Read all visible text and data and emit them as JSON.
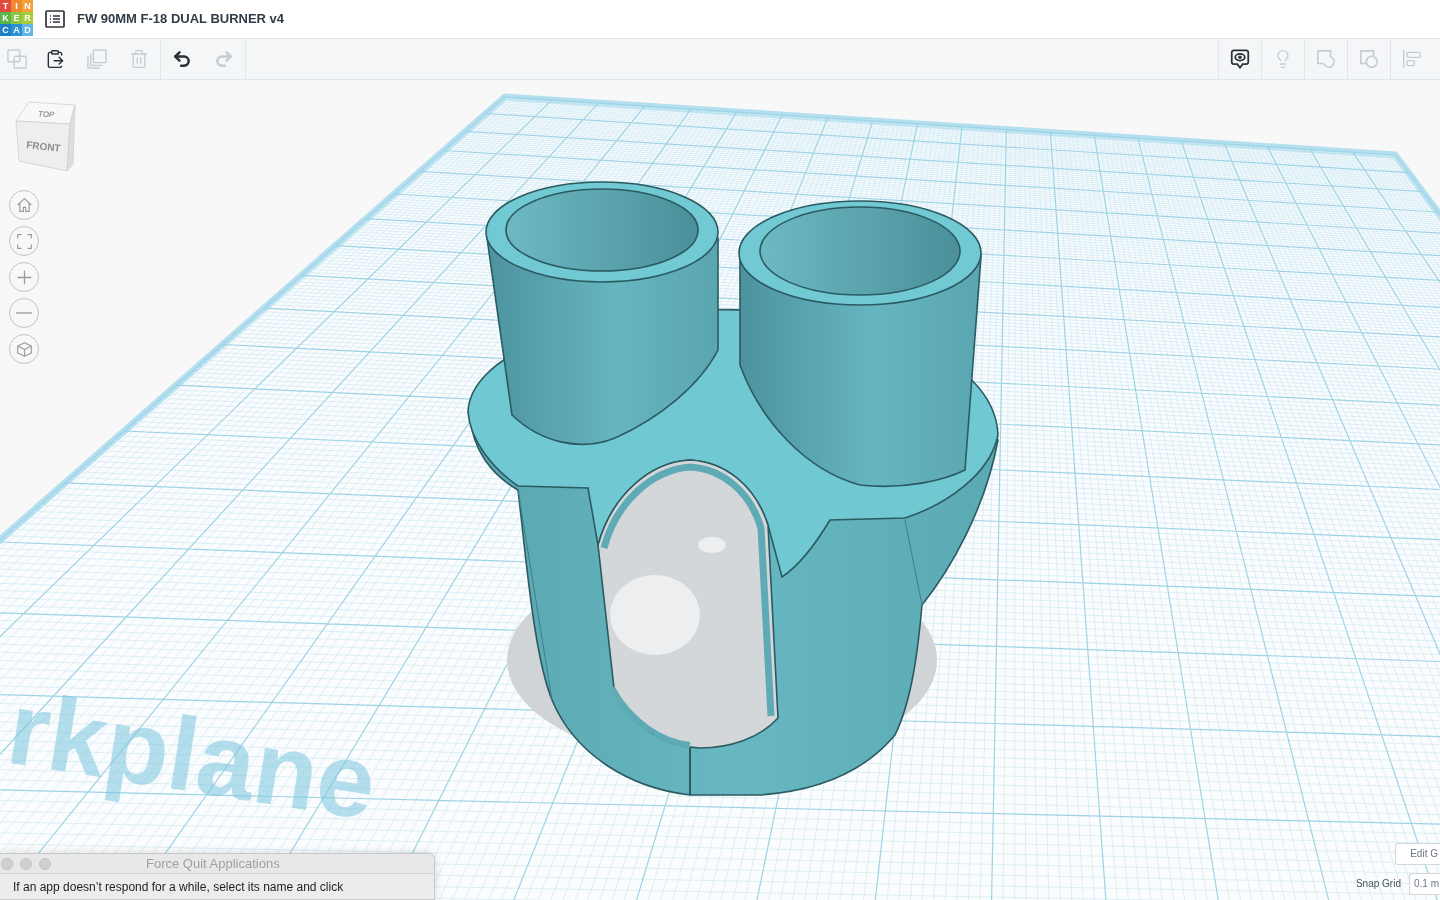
{
  "logo": [
    {
      "letter": "T",
      "color": "#e5483f"
    },
    {
      "letter": "I",
      "color": "#f0892e"
    },
    {
      "letter": "N",
      "color": "#f5a13a"
    },
    {
      "letter": "K",
      "color": "#59b548"
    },
    {
      "letter": "E",
      "color": "#8cc63f"
    },
    {
      "letter": "R",
      "color": "#a5cd39"
    },
    {
      "letter": "C",
      "color": "#1f7fc4"
    },
    {
      "letter": "A",
      "color": "#2a91d2"
    },
    {
      "letter": "D",
      "color": "#63b5e5"
    }
  ],
  "header": {
    "title": "FW 90MM F-18 DUAL BURNER v4"
  },
  "toolbar": {
    "edit_buttons": [
      {
        "kind": "copy",
        "disabled": true
      },
      {
        "kind": "paste",
        "disabled": false
      },
      {
        "kind": "duplicate",
        "disabled": true
      },
      {
        "kind": "delete",
        "disabled": true
      }
    ],
    "history_buttons": [
      {
        "kind": "undo",
        "disabled": false
      },
      {
        "kind": "redo",
        "disabled": true
      }
    ],
    "view_buttons": [
      {
        "kind": "notes",
        "disabled": false
      },
      {
        "kind": "show_hide",
        "disabled": true
      },
      {
        "kind": "group",
        "disabled": true
      },
      {
        "kind": "ungroup",
        "disabled": true
      },
      {
        "kind": "align",
        "disabled": true
      }
    ]
  },
  "view_cube": {
    "top": "TOP",
    "front": "FRONT"
  },
  "view_controls": [
    {
      "kind": "home"
    },
    {
      "kind": "fit"
    },
    {
      "kind": "zoom_in"
    },
    {
      "kind": "zoom_out"
    },
    {
      "kind": "projection"
    }
  ],
  "workplane": {
    "label": "rkplane"
  },
  "grid_controls": {
    "edit_button": "Edit G",
    "snap_label": "Snap Grid",
    "snap_value": "0.1 m"
  },
  "force_quit_window": {
    "title": "Force Quit Applications",
    "message": "If an app doesn’t respond for a while, select its name and click"
  }
}
